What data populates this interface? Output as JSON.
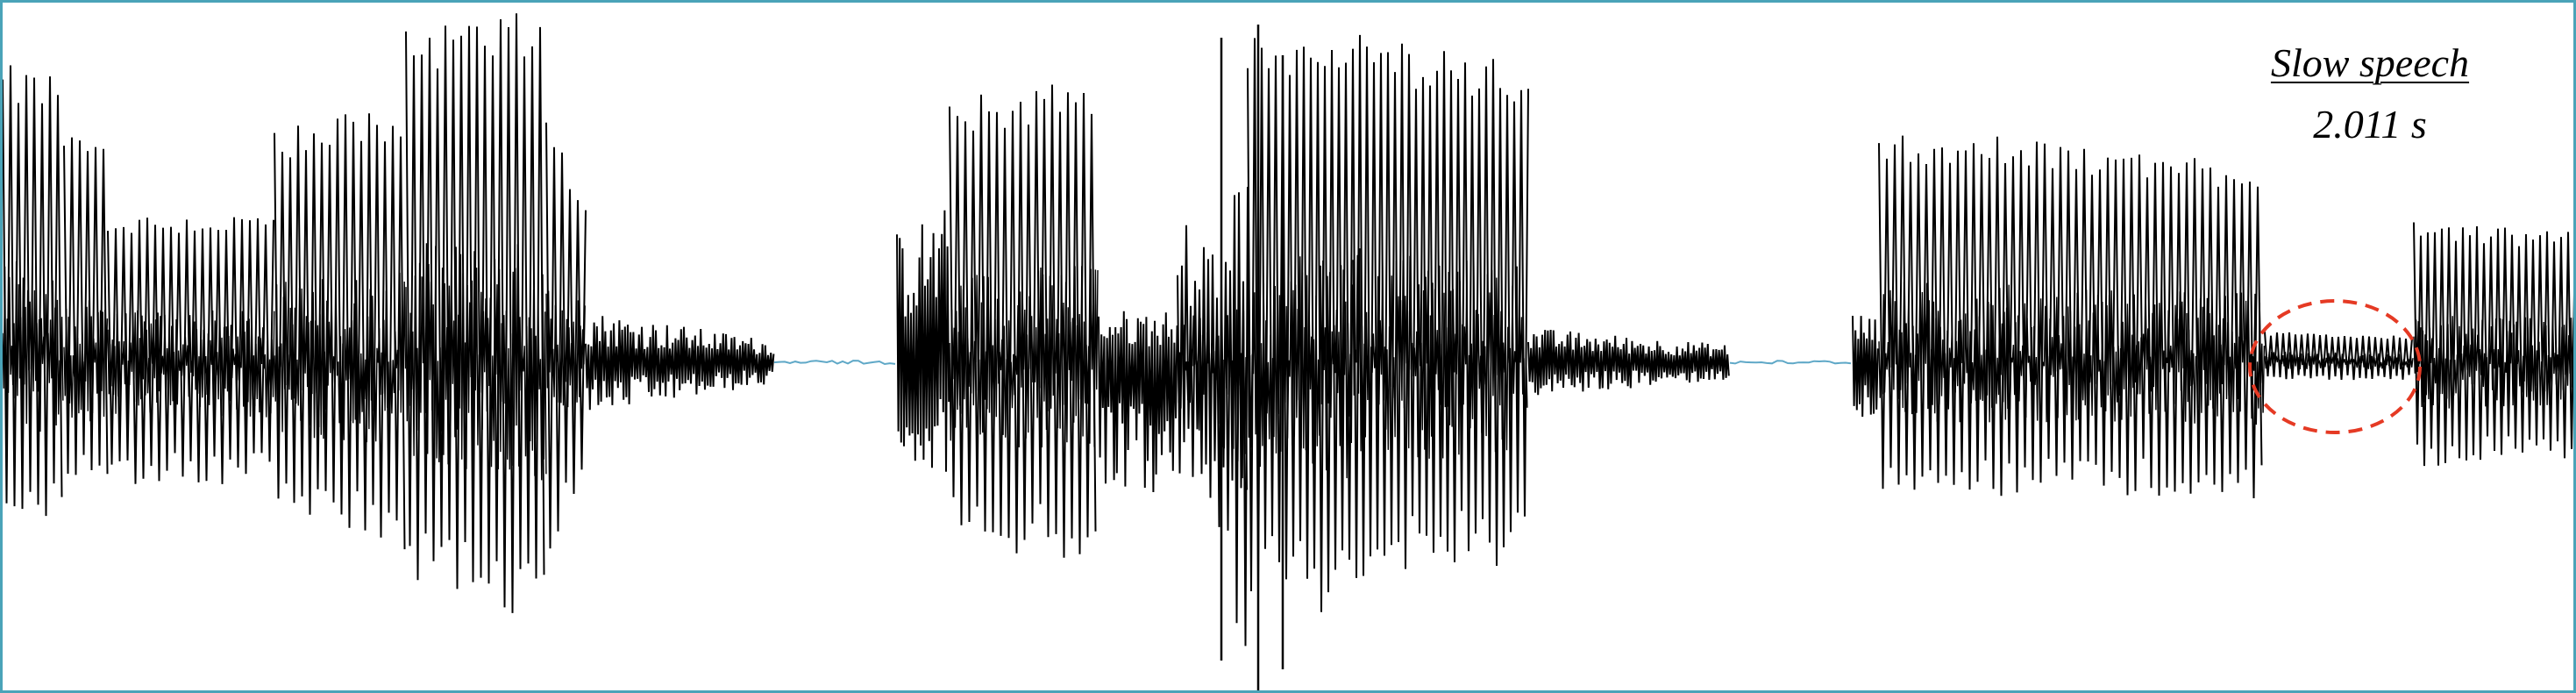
{
  "caption": {
    "title": "Slow speech",
    "duration": "2.011 s"
  },
  "colors": {
    "background": "#ffffff",
    "waveform": "#000000",
    "silence_trace": "#5fa8c7",
    "highlight_ellipse": "#e53a24",
    "frame_border": "#4aa3b8"
  },
  "waveform": {
    "description_segments": [
      {
        "name": "voiced-segment-1",
        "style": "voiced"
      },
      {
        "name": "fricative-segment-1",
        "style": "noise"
      },
      {
        "name": "silence-1",
        "style": "silence"
      },
      {
        "name": "voiced-segment-2",
        "style": "voiced"
      },
      {
        "name": "fricative-segment-2",
        "style": "noise"
      },
      {
        "name": "silence-2",
        "style": "silence"
      },
      {
        "name": "voiced-segment-3",
        "style": "voiced"
      }
    ]
  },
  "annotation": {
    "highlight": "dashed-ellipse"
  }
}
